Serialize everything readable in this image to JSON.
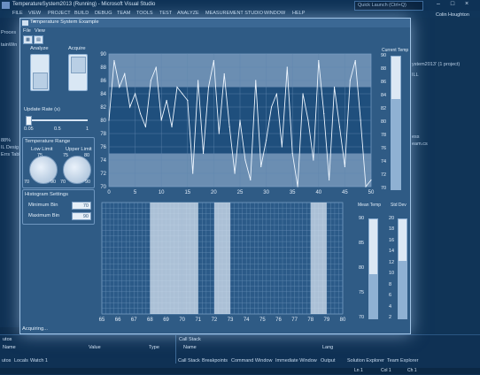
{
  "vs": {
    "window_title": "TemperatureSystem2013 (Running) - Microsoft Visual Studio",
    "menu": [
      "FILE",
      "VIEW",
      "PROJECT",
      "BUILD",
      "DEBUG",
      "TEAM",
      "TOOLS",
      "TEST",
      "ANALYZE",
      "MEASUREMENT STUDIO",
      "WINDOW",
      "HELP"
    ],
    "quick_launch": "Quick Launch (Ctrl+Q)",
    "user": "Colin Houghton",
    "left_labels": [
      "Proces",
      "tainWin",
      "88%",
      "IL Desig",
      "Errs Tables"
    ],
    "right_labels": [
      "ystem2013' (1 project)",
      "ILL",
      "ess",
      "eam.cs"
    ],
    "bottom_left_title": "utos",
    "bottom_left_cols": [
      "Name",
      "Value",
      "Type"
    ],
    "bottom_left_tabs": [
      "utos",
      "Locals",
      "Watch 1"
    ],
    "call_stack_title": "Call Stack",
    "call_stack_cols": [
      "Name",
      "Lang"
    ],
    "call_stack_tabs": [
      "Call Stack",
      "Breakpoints",
      "Command Window",
      "Immediate Window",
      "Output"
    ],
    "right_bottom_tabs": [
      "Solution Explorer",
      "Team Explorer"
    ],
    "status_items": [
      "Ln 1",
      "Col 1",
      "Ch 1"
    ]
  },
  "app": {
    "title": "Temperature System Example",
    "menu": [
      "File",
      "View"
    ],
    "analyze_label": "Analyze",
    "acquire_label": "Acquire",
    "update_rate_label": "Update Rate (s)",
    "update_rate_ticks": [
      "0.05",
      "0.5",
      "1"
    ],
    "temp_range_label": "Temperature Range",
    "lower_limit_label": "Low Limit",
    "upper_limit_label": "Upper Limit",
    "lower_knob_ticks": [
      "75",
      "70",
      "90"
    ],
    "upper_knob_ticks": [
      "75",
      "80",
      "70",
      "90"
    ],
    "histogram_label": "Histogram Settings",
    "min_bin_label": "Minimum Bin",
    "min_bin_value": "70",
    "max_bin_label": "Maximum Bin",
    "max_bin_value": "90",
    "status_text": "Acquiring...",
    "current_temp_label": "Current Temp",
    "current_temp_ticks": [
      "90",
      "88",
      "86",
      "84",
      "82",
      "80",
      "78",
      "76",
      "74",
      "72",
      "70"
    ],
    "mean_temp_label": "Mean Temp",
    "std_dev_label": "Std Dev",
    "gauge_ticks": [
      "90",
      "85",
      "80",
      "75",
      "70"
    ],
    "std_ticks": [
      "20",
      "18",
      "16",
      "14",
      "12",
      "10",
      "8",
      "6",
      "4",
      "2"
    ],
    "current_temp_level": 0.68,
    "mean_temp_level": 0.45,
    "std_dev_level": 0.58
  },
  "chart_data": [
    {
      "type": "line",
      "xlim": [
        0,
        50
      ],
      "ylim": [
        70,
        90
      ],
      "x_ticks": [
        "0",
        "5",
        "10",
        "15",
        "20",
        "25",
        "30",
        "35",
        "40",
        "45",
        "50"
      ],
      "y_ticks": [
        "90",
        "88",
        "86",
        "84",
        "82",
        "80",
        "78",
        "76",
        "74",
        "72",
        "70"
      ],
      "bands": [
        [
          85,
          90
        ],
        [
          70,
          75
        ]
      ],
      "series": [
        {
          "x": [
            0,
            1,
            2,
            3,
            4,
            5,
            6,
            7,
            8,
            9,
            10,
            11,
            12,
            13,
            14,
            15,
            16,
            17,
            18,
            19,
            20,
            21,
            22,
            23,
            24,
            25,
            26,
            27,
            28,
            29,
            30,
            31,
            32,
            33,
            34,
            35,
            36,
            37,
            38,
            39,
            40,
            41,
            42,
            43,
            44,
            45,
            46,
            47,
            48,
            49,
            50
          ],
          "values": [
            80,
            89,
            85,
            87,
            82,
            84,
            81,
            79,
            86,
            88,
            80,
            83,
            79,
            85,
            84,
            83,
            72,
            86,
            75,
            85,
            89,
            78,
            87,
            79,
            72,
            80,
            74,
            71,
            86,
            73,
            77,
            82,
            84,
            76,
            88,
            75,
            70,
            84,
            80,
            74,
            89,
            81,
            71,
            85,
            79,
            73,
            86,
            89,
            80,
            70,
            71
          ]
        }
      ]
    },
    {
      "type": "bar",
      "xlim": [
        65,
        80
      ],
      "x_ticks": [
        "65",
        "66",
        "67",
        "68",
        "69",
        "70",
        "71",
        "72",
        "73",
        "74",
        "75",
        "76",
        "77",
        "78",
        "79",
        "80"
      ],
      "bins": [
        68,
        69,
        70,
        72,
        78
      ],
      "values": [
        1,
        1,
        1,
        1,
        1
      ]
    }
  ]
}
